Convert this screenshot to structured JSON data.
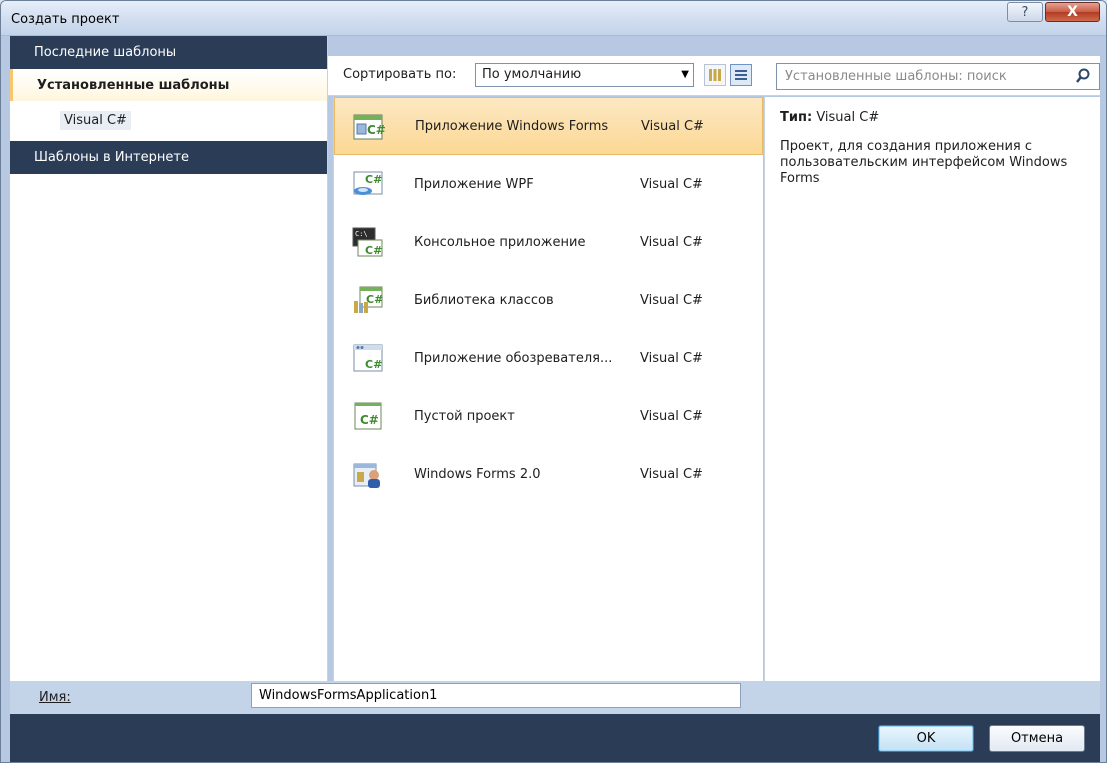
{
  "window": {
    "title": "Создать проект",
    "help_label": "?",
    "close_label": "X"
  },
  "sidebar": {
    "recent": "Последние шаблоны",
    "installed": "Установленные шаблоны",
    "installed_child": "Visual C#",
    "online": "Шаблоны в Интернете"
  },
  "toolbar": {
    "sort_label": "Сортировать по:",
    "sort_value": "По умолчанию",
    "search_placeholder": "Установленные шаблоны: поиск"
  },
  "templates": [
    {
      "name": "Приложение Windows Forms",
      "lang": "Visual C#",
      "icon": "winforms-csharp-icon",
      "selected": true
    },
    {
      "name": "Приложение WPF",
      "lang": "Visual C#",
      "icon": "wpf-csharp-icon",
      "selected": false
    },
    {
      "name": "Консольное приложение",
      "lang": "Visual C#",
      "icon": "console-csharp-icon",
      "selected": false
    },
    {
      "name": "Библиотека классов",
      "lang": "Visual C#",
      "icon": "class-library-icon",
      "selected": false
    },
    {
      "name": "Приложение обозревателя...",
      "lang": "Visual C#",
      "icon": "browser-app-icon",
      "selected": false
    },
    {
      "name": "Пустой проект",
      "lang": "Visual C#",
      "icon": "empty-project-icon",
      "selected": false
    },
    {
      "name": "Windows Forms 2.0",
      "lang": "Visual C#",
      "icon": "winforms-2-icon",
      "selected": false
    }
  ],
  "details": {
    "type_label": "Тип:",
    "type_value": "Visual C#",
    "description": "Проект, для создания приложения с пользовательским интерфейсом Windows Forms"
  },
  "name_field": {
    "label": "Имя:",
    "value": "WindowsFormsApplication1"
  },
  "buttons": {
    "ok": "OK",
    "cancel": "Отмена"
  },
  "colors": {
    "nav_header": "#2b3c57",
    "selection": "#fbd894",
    "footer": "#2b3c57"
  }
}
